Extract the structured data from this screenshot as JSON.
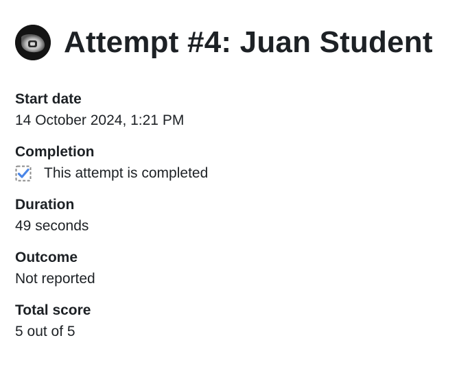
{
  "header": {
    "title": "Attempt #4: Juan Student",
    "avatar_icon": "user-avatar"
  },
  "fields": {
    "start_date": {
      "label": "Start date",
      "value": "14 October 2024, 1:21 PM"
    },
    "completion": {
      "label": "Completion",
      "value": "This attempt is completed",
      "icon": "completed-checkbox-icon"
    },
    "duration": {
      "label": "Duration",
      "value": "49 seconds"
    },
    "outcome": {
      "label": "Outcome",
      "value": "Not reported"
    },
    "total_score": {
      "label": "Total score",
      "value": "5 out of 5"
    }
  },
  "colors": {
    "text": "#1d2125",
    "check": "#4a86e8",
    "checkbox_border": "#8a8a8a"
  }
}
